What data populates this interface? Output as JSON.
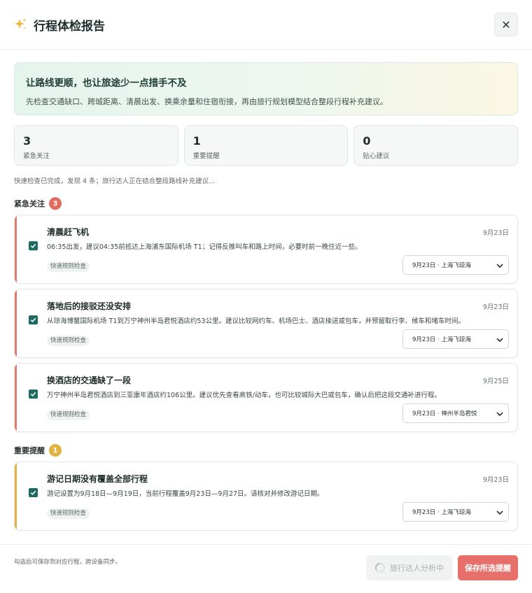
{
  "header": {
    "title": "行程体检报告",
    "close_label": "✕"
  },
  "hero": {
    "heading": "让路线更顺，也让旅途少一点措手不及",
    "text": "先检查交通缺口、跨城距离、清晨出发、换乘余量和住宿衔接，再由旅行规划模型结合整段行程补充建议。"
  },
  "stats": [
    {
      "number": "3",
      "label": "紧急关注"
    },
    {
      "number": "1",
      "label": "重要提醒"
    },
    {
      "number": "0",
      "label": "贴心建议"
    }
  ],
  "progress_text": "快速检查已完成，发现 4 条；旅行达人正在结合整段路线补充建议...",
  "sections": [
    {
      "title": "紧急关注",
      "count": "3"
    },
    {
      "title": "重要提醒",
      "count": "1"
    }
  ],
  "cards": [
    {
      "title": "清晨赶飞机",
      "date": "9月23日",
      "desc": "06:35出发，建议04:35前抵达上海浦东国际机场 T1；记得反推叫车和路上时间，必要时前一晚住近一些。",
      "tag": "快速规则检查",
      "select": "9月23日 · 上海飞琼海",
      "checked": true
    },
    {
      "title": "落地后的接驳还没安排",
      "date": "9月23日",
      "desc": "从琼海博鳌国际机场 T1到万宁神州半岛君悦酒店约53公里。建议比较网约车、机场巴士、酒店接送或包车，并预留取行李、候车和堵车时间。",
      "tag": "快速规则检查",
      "select": "9月23日 · 上海飞琼海",
      "checked": true
    },
    {
      "title": "换酒店的交通缺了一段",
      "date": "9月25日",
      "desc": "万宁神州半岛君悦酒店到三亚康年酒店约106公里。建议优先查看高铁/动车，也可比较城际大巴或包车，确认后把这段交通补进行程。",
      "tag": "快速规则检查",
      "select": "9月23日 · 神州半岛君悦",
      "checked": true
    },
    {
      "title": "游记日期没有覆盖全部行程",
      "date": "9月23日",
      "desc": "游记设置为9月18日—9月19日，当前行程覆盖9月23日—9月27日。请核对并修改游记日期。",
      "tag": "快速规则检查",
      "select": "9月23日 · 上海飞琼海",
      "checked": true
    }
  ],
  "footer": {
    "hint": "勾选后可保存到对应行程，跨设备同步。",
    "analyzing_label": "旅行达人分析中",
    "save_label": "保存所选提醒"
  },
  "colors": {
    "urgent": "#e07a70",
    "important": "#e2b340",
    "check": "#1f6b63",
    "save": "#e8706a"
  }
}
